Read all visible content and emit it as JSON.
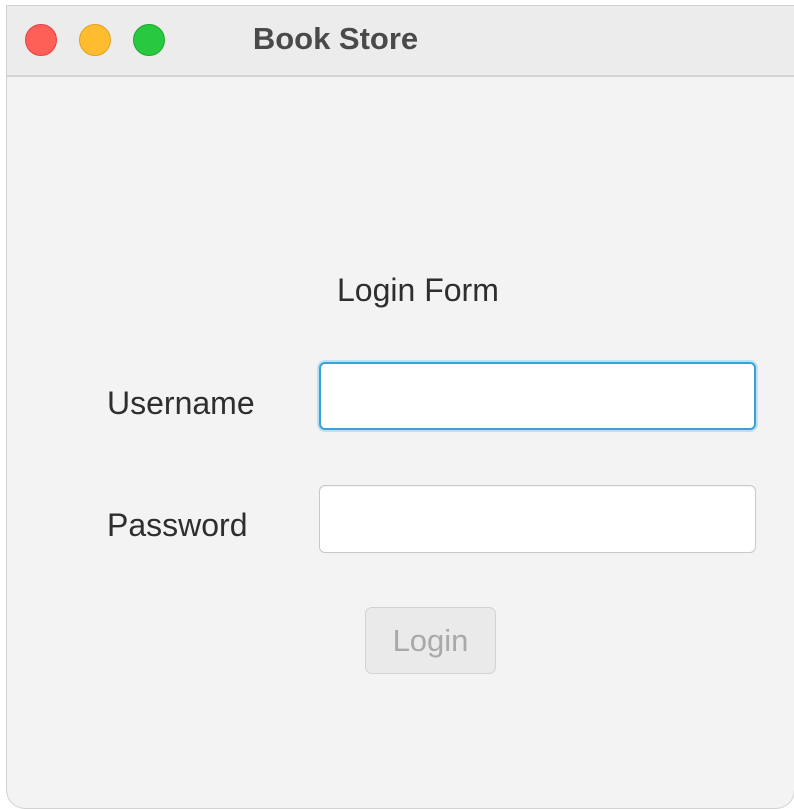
{
  "window": {
    "title": "Book Store",
    "controls": {
      "close_color": "#fe5f57",
      "minimize_color": "#febc2e",
      "zoom_color": "#28c840"
    }
  },
  "form": {
    "title": "Login Form",
    "username": {
      "label": "Username",
      "value": "",
      "placeholder": "",
      "focused": true
    },
    "password": {
      "label": "Password",
      "value": "",
      "placeholder": ""
    },
    "submit": {
      "label": "Login",
      "enabled": false
    }
  },
  "colors": {
    "focus_ring": "#3aa1d8",
    "window_background": "#f3f3f3",
    "disabled_text": "#a9a9a9"
  }
}
